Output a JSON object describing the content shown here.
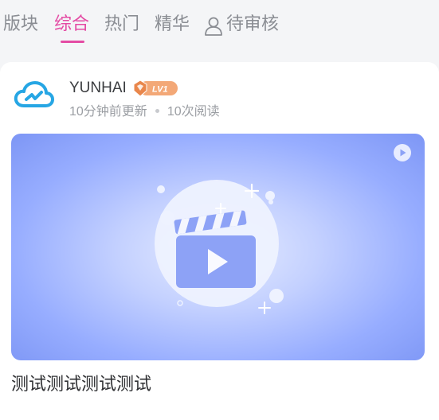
{
  "tabs": [
    {
      "label": "版块",
      "active": false
    },
    {
      "label": "综合",
      "active": true
    },
    {
      "label": "热门",
      "active": false
    },
    {
      "label": "精华",
      "active": false
    },
    {
      "label": "待审核",
      "active": false,
      "icon": "person-icon"
    }
  ],
  "post": {
    "author": "YUNHAI",
    "level": "LV1",
    "updated_num": "10",
    "updated_text": "分钟前更新",
    "reads_num": "10",
    "reads_text": "次阅读",
    "title": "测试测试测试测试"
  },
  "colors": {
    "accent": "#e44ba4",
    "badge": "#f0995a",
    "cover": "#7d96f5"
  },
  "icons": [
    "person-icon",
    "cloud-logo-icon",
    "level-badge-icon",
    "play-circle-icon",
    "video-clapper-illustration"
  ]
}
